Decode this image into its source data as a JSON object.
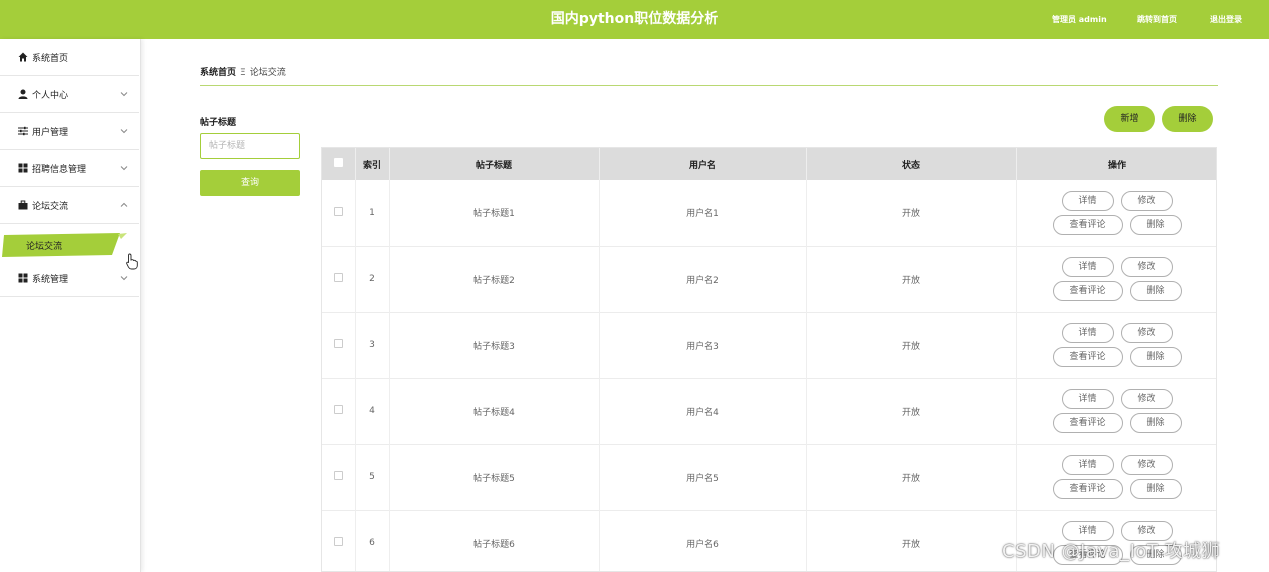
{
  "header": {
    "title": "国内python职位数据分析",
    "admin_label": "管理员 admin",
    "links": [
      "跳转到首页",
      "退出登录"
    ],
    "accent_color": "#a4ce3a"
  },
  "sidebar": {
    "items": [
      {
        "label": "系统首页",
        "icon": "home-icon"
      },
      {
        "label": "个人中心",
        "icon": "user-icon"
      },
      {
        "label": "用户管理",
        "icon": "sliders-icon"
      },
      {
        "label": "招聘信息管理",
        "icon": "grid-icon"
      },
      {
        "label": "论坛交流",
        "icon": "briefcase-icon"
      },
      {
        "label": "系统管理",
        "icon": "grid-icon"
      }
    ],
    "active_sub": "论坛交流"
  },
  "breadcrumb": {
    "home": "系统首页",
    "separator": "Ξ",
    "current": "论坛交流"
  },
  "search": {
    "label": "帖子标题",
    "placeholder": "帖子标题",
    "button": "查询"
  },
  "actions": {
    "add": "新增",
    "delete": "删除"
  },
  "table": {
    "headers": [
      "索引",
      "帖子标题",
      "用户名",
      "状态",
      "操作"
    ],
    "op_labels": {
      "detail": "详情",
      "edit": "修改",
      "comments": "查看评论",
      "delete": "删除"
    },
    "rows": [
      {
        "index": "1",
        "title": "帖子标题1",
        "user": "用户名1",
        "status": "开放"
      },
      {
        "index": "2",
        "title": "帖子标题2",
        "user": "用户名2",
        "status": "开放"
      },
      {
        "index": "3",
        "title": "帖子标题3",
        "user": "用户名3",
        "status": "开放"
      },
      {
        "index": "4",
        "title": "帖子标题4",
        "user": "用户名4",
        "status": "开放"
      },
      {
        "index": "5",
        "title": "帖子标题5",
        "user": "用户名5",
        "status": "开放"
      },
      {
        "index": "6",
        "title": "帖子标题6",
        "user": "用户名6",
        "status": "开放"
      }
    ]
  },
  "watermark": "CSDN @Java_IoT 攻城狮"
}
